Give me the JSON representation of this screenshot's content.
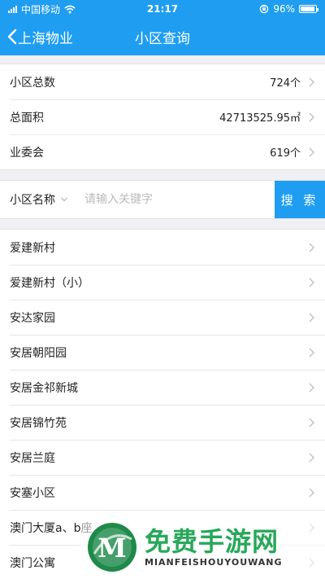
{
  "status_bar": {
    "carrier": "中国移动",
    "time": "21:17",
    "battery": "96%",
    "battery_level": 0.96
  },
  "nav": {
    "back_label": "上海物业",
    "title": "小区查询"
  },
  "stats": [
    {
      "label": "小区总数",
      "value": "724个"
    },
    {
      "label": "总面积",
      "value": "42713525.95㎡"
    },
    {
      "label": "业委会",
      "value": "619个"
    }
  ],
  "search": {
    "filter_label": "小区名称",
    "placeholder": "请输入关键字",
    "button_label": "搜 索"
  },
  "communities": [
    "爱建新村",
    "爱建新村（小）",
    "安达家园",
    "安居朝阳园",
    "安居金祁新城",
    "安居锦竹苑",
    "安居兰庭",
    "安塞小区",
    "澳门大厦a、b座",
    "澳门公寓"
  ],
  "watermark": {
    "cn": "免费手游网",
    "en": "MIANFEISHOUYOUWANG",
    "logo_letter": "M"
  },
  "colors": {
    "primary": "#1f9ef1",
    "watermark_green": "#28a85a"
  }
}
